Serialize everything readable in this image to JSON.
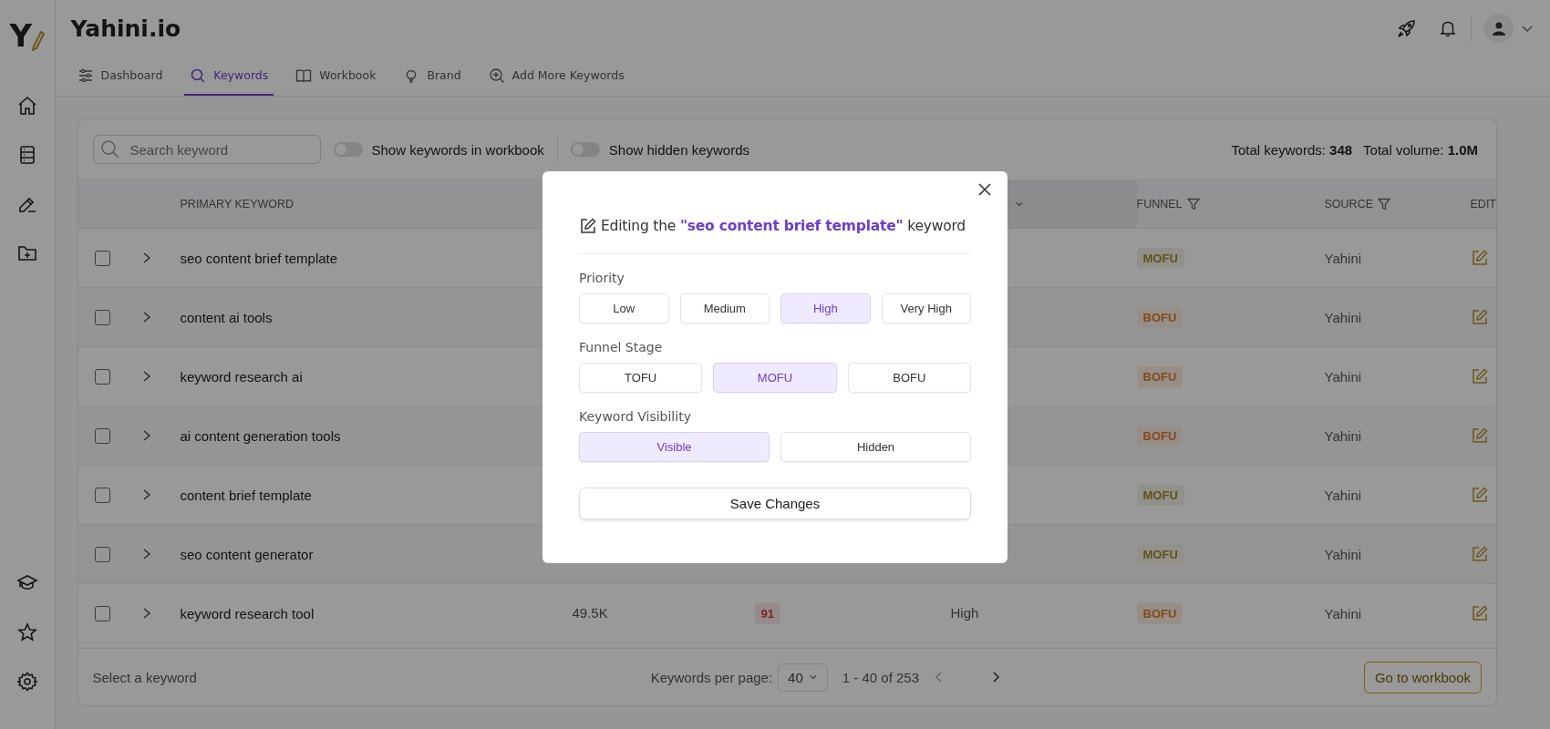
{
  "app": {
    "logo_letter": "Y",
    "title": "Yahini.io"
  },
  "tabs": [
    {
      "label": "Dashboard",
      "selected": false
    },
    {
      "label": "Keywords",
      "selected": true
    },
    {
      "label": "Workbook",
      "selected": false
    },
    {
      "label": "Brand",
      "selected": false
    },
    {
      "label": "Add More Keywords",
      "selected": false
    }
  ],
  "toolbar": {
    "search": {
      "placeholder": "Search keyword"
    },
    "toggles": [
      {
        "label": "Show keywords in workbook",
        "on": false
      },
      {
        "label": "Show hidden keywords",
        "on": false
      }
    ],
    "totals": [
      {
        "label": "Total keywords:",
        "value": "348"
      },
      {
        "label": "Total volume:",
        "value": "1.0M"
      }
    ]
  },
  "table": {
    "columns": {
      "keyword": "PRIMARY KEYWORD",
      "funnel": "FUNNEL",
      "source": "SOURCE",
      "edit": "EDIT"
    },
    "rows": [
      {
        "checked": false,
        "keyword": "seo content brief template",
        "funnel": {
          "label": "MOFU",
          "kind": "middle"
        },
        "source": "Yahini"
      },
      {
        "checked": false,
        "keyword": "content ai tools",
        "funnel": {
          "label": "BOFU",
          "kind": "bottom"
        },
        "source": "Yahini"
      },
      {
        "checked": false,
        "keyword": "keyword research ai",
        "funnel": {
          "label": "BOFU",
          "kind": "bottom"
        },
        "source": "Yahini"
      },
      {
        "checked": false,
        "keyword": "ai content generation tools",
        "funnel": {
          "label": "BOFU",
          "kind": "bottom"
        },
        "source": "Yahini"
      },
      {
        "checked": false,
        "keyword": "content brief template",
        "funnel": {
          "label": "MOFU",
          "kind": "middle"
        },
        "source": "Yahini"
      },
      {
        "checked": false,
        "keyword": "seo content generator",
        "funnel": {
          "label": "MOFU",
          "kind": "middle"
        },
        "source": "Yahini"
      },
      {
        "checked": false,
        "keyword": "keyword research tool",
        "volume": "49.5K",
        "difficulty": {
          "label": "91",
          "kind": "hard"
        },
        "priority": "High",
        "funnel": {
          "label": "BOFU",
          "kind": "bottom"
        },
        "source": "Yahini"
      }
    ]
  },
  "footer": {
    "selection": "Select a keyword",
    "per_page_label": "Keywords per page:",
    "per_page": "40",
    "range": "1 - 40 of 253",
    "action": "Go to workbook"
  },
  "modal": {
    "title": "Editing the **\"seo content brief template\"** keyword",
    "groups": [
      {
        "label": "Priority",
        "options": [
          {
            "label": "Low",
            "selected": false
          },
          {
            "label": "Medium",
            "selected": false
          },
          {
            "label": "High",
            "selected": true
          },
          {
            "label": "Very High",
            "selected": false
          }
        ]
      },
      {
        "label": "Funnel Stage",
        "options": [
          {
            "label": "TOFU",
            "selected": false
          },
          {
            "label": "MOFU",
            "selected": true
          },
          {
            "label": "BOFU",
            "selected": false
          }
        ]
      },
      {
        "label": "Keyword Visibility",
        "options": [
          {
            "label": "Visible",
            "selected": true
          },
          {
            "label": "Hidden",
            "selected": false
          }
        ]
      }
    ],
    "save": "Save Changes"
  }
}
